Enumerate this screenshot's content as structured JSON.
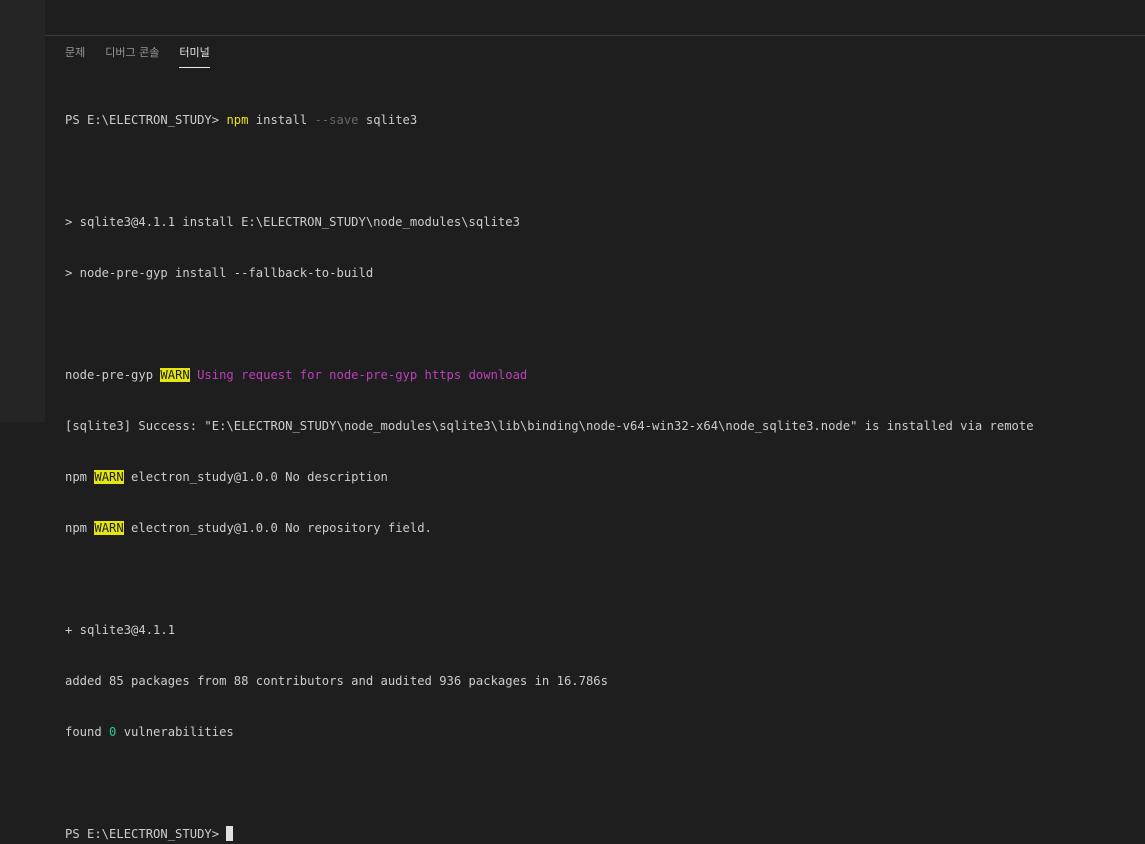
{
  "panel": {
    "tabs": [
      {
        "label": "문제"
      },
      {
        "label": "디버그 콘솔"
      },
      {
        "label": "터미널",
        "active": true
      }
    ]
  },
  "terminal": {
    "line1": {
      "prompt": "PS E:\\ELECTRON_STUDY> ",
      "cmd": "npm",
      "arg1": " install ",
      "flag": "--save",
      "arg2": " sqlite3"
    },
    "line3": "> sqlite3@4.1.1 install E:\\ELECTRON_STUDY\\node_modules\\sqlite3",
    "line4": "> node-pre-gyp install --fallback-to-build",
    "line6": {
      "prefix": "node-pre-gyp ",
      "warn": "WARN",
      "msg": " Using request for node-pre-gyp https download"
    },
    "line7": "[sqlite3] Success: \"E:\\ELECTRON_STUDY\\node_modules\\sqlite3\\lib\\binding\\node-v64-win32-x64\\node_sqlite3.node\" is installed via remote",
    "line8": {
      "prefix": "npm ",
      "warn": "WARN",
      "msg": " electron_study@1.0.0 No description"
    },
    "line9": {
      "prefix": "npm ",
      "warn": "WARN",
      "msg": " electron_study@1.0.0 No repository field."
    },
    "line11": "+ sqlite3@4.1.1",
    "line12": "added 85 packages from 88 contributors and audited 936 packages in 16.786s",
    "line13": {
      "prefix": "found ",
      "count": "0",
      "suffix": " vulnerabilities"
    },
    "line15": {
      "prompt": "PS E:\\ELECTRON_STUDY> "
    }
  },
  "colors": {
    "background": "#1e1e1e",
    "foreground": "#cccccc",
    "yellow": "#e5e510",
    "magenta": "#bc3fbc",
    "green": "#23d18b",
    "gray": "#666666"
  }
}
